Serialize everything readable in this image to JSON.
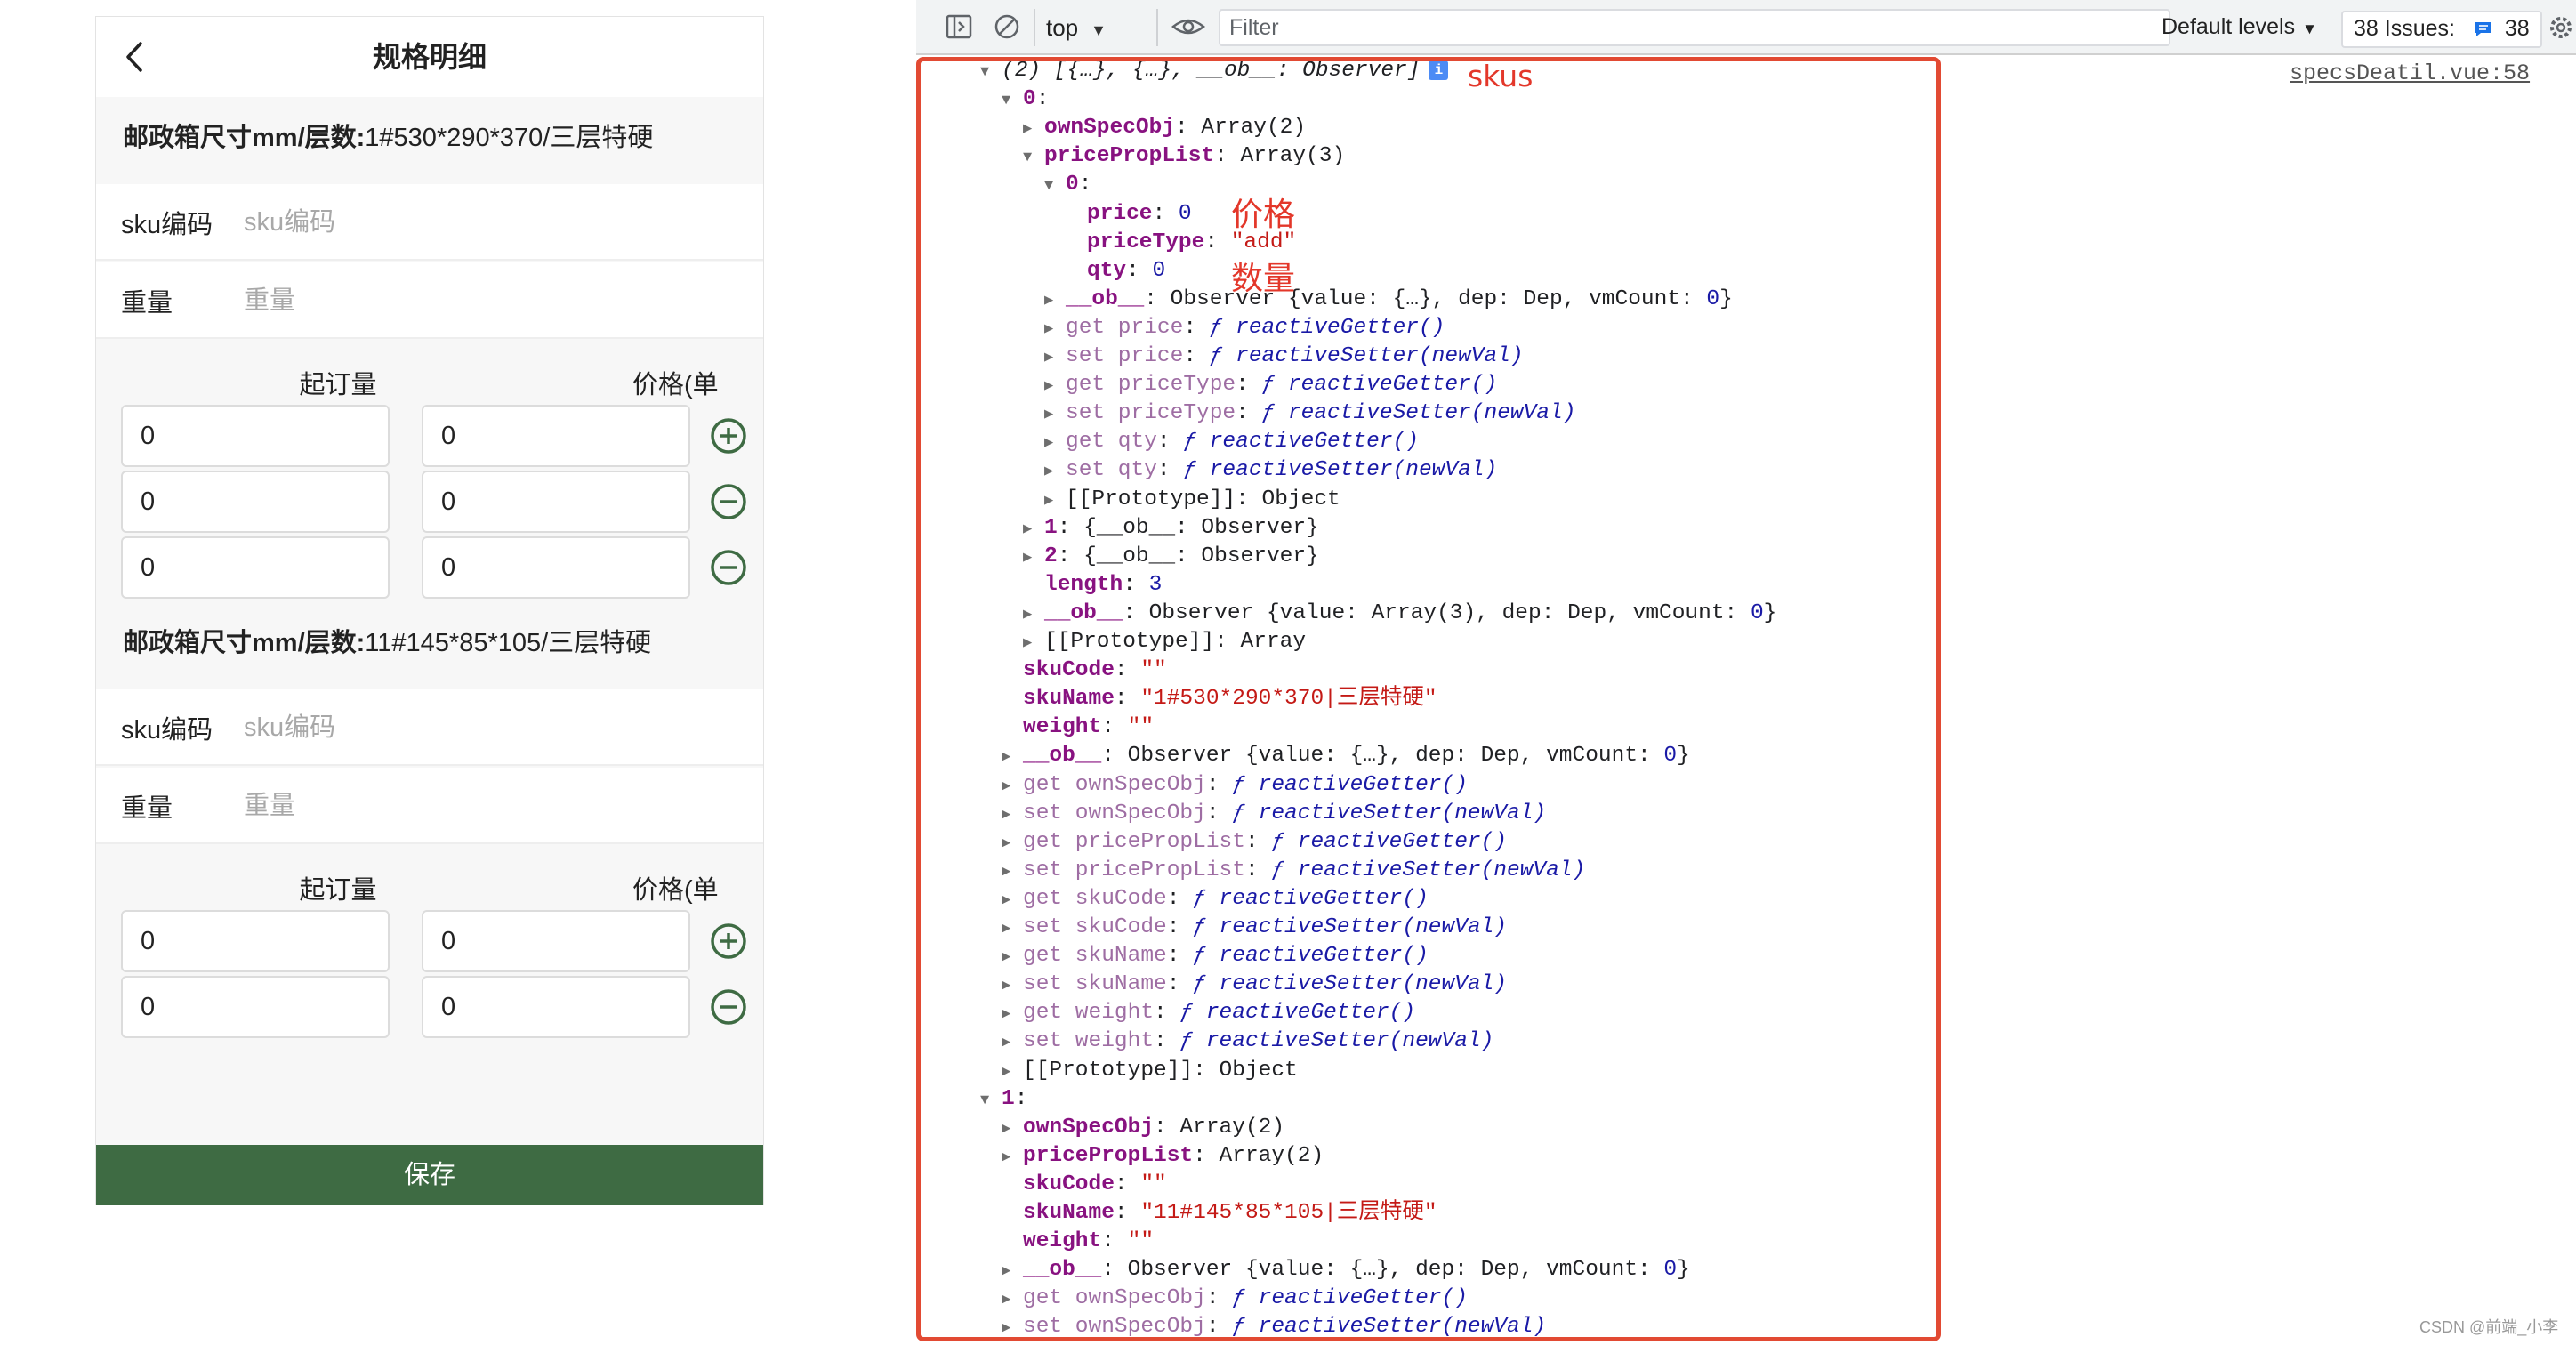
{
  "form": {
    "title": "规格明细",
    "save_label": "保存",
    "skus": [
      {
        "name_label": "邮政箱尺寸mm/层数:",
        "name_value": "1#530*290*370/三层特硬",
        "sku_code_label": "sku编码",
        "sku_code_placeholder": "sku编码",
        "weight_label": "重量",
        "weight_placeholder": "重量",
        "qty_header": "起订量",
        "price_header": "价格(单价)",
        "tiers": [
          {
            "qty": "0",
            "price": "0",
            "action": "add-circle-icon"
          },
          {
            "qty": "0",
            "price": "0",
            "action": "remove-circle-icon"
          },
          {
            "qty": "0",
            "price": "0",
            "action": "remove-circle-icon"
          }
        ]
      },
      {
        "name_label": "邮政箱尺寸mm/层数:",
        "name_value": "11#145*85*105/三层特硬",
        "sku_code_label": "sku编码",
        "sku_code_placeholder": "sku编码",
        "weight_label": "重量",
        "weight_placeholder": "重量",
        "qty_header": "起订量",
        "price_header": "价格(单价)",
        "tiers": [
          {
            "qty": "0",
            "price": "0",
            "action": "add-circle-icon"
          },
          {
            "qty": "0",
            "price": "0",
            "action": "remove-circle-icon"
          }
        ]
      }
    ]
  },
  "devtools": {
    "context": "top",
    "filter_placeholder": "Filter",
    "levels": "Default levels",
    "issues_label": "38 Issues:",
    "issues_count": "38",
    "source_link": "specsDeatil.vue:58",
    "lines": [
      [
        {
          "t": "▼",
          "c": "tri"
        },
        {
          "t": "(2) [{…}, {…}, __ob__: Observer]",
          "c": "it"
        },
        {
          "t": "i",
          "c": "info"
        }
      ],
      [
        {
          "t": "▼",
          "c": "tri"
        },
        {
          "t": "0",
          "c": "k"
        },
        {
          "t": ":"
        }
      ],
      [
        {
          "t": "▶",
          "c": "tri"
        },
        {
          "t": "ownSpecObj",
          "c": "k"
        },
        {
          "t": ": Array(2)"
        }
      ],
      [
        {
          "t": "▼",
          "c": "tri"
        },
        {
          "t": "pricePropList",
          "c": "k"
        },
        {
          "t": ": Array(3)"
        }
      ],
      [
        {
          "t": "▼",
          "c": "tri"
        },
        {
          "t": "0",
          "c": "k"
        },
        {
          "t": ":"
        }
      ],
      [
        {
          "t": "price",
          "c": "k"
        },
        {
          "t": ": "
        },
        {
          "t": "0",
          "c": "n"
        }
      ],
      [
        {
          "t": "priceType",
          "c": "k"
        },
        {
          "t": ": "
        },
        {
          "t": "\"add\"",
          "c": "s"
        }
      ],
      [
        {
          "t": "qty",
          "c": "k"
        },
        {
          "t": ": "
        },
        {
          "t": "0",
          "c": "n"
        }
      ],
      [
        {
          "t": "▶",
          "c": "tri"
        },
        {
          "t": "__ob__",
          "c": "k"
        },
        {
          "t": ": Observer {value: {…}, dep: Dep, vmCount: "
        },
        {
          "t": "0",
          "c": "n"
        },
        {
          "t": "}"
        }
      ],
      [
        {
          "t": "▶",
          "c": "tri"
        },
        {
          "t": "get price",
          "c": "ka"
        },
        {
          "t": ": "
        },
        {
          "t": "ƒ reactiveGetter()",
          "c": "fn"
        }
      ],
      [
        {
          "t": "▶",
          "c": "tri"
        },
        {
          "t": "set price",
          "c": "ka"
        },
        {
          "t": ": "
        },
        {
          "t": "ƒ reactiveSetter(newVal)",
          "c": "fn"
        }
      ],
      [
        {
          "t": "▶",
          "c": "tri"
        },
        {
          "t": "get priceType",
          "c": "ka"
        },
        {
          "t": ": "
        },
        {
          "t": "ƒ reactiveGetter()",
          "c": "fn"
        }
      ],
      [
        {
          "t": "▶",
          "c": "tri"
        },
        {
          "t": "set priceType",
          "c": "ka"
        },
        {
          "t": ": "
        },
        {
          "t": "ƒ reactiveSetter(newVal)",
          "c": "fn"
        }
      ],
      [
        {
          "t": "▶",
          "c": "tri"
        },
        {
          "t": "get qty",
          "c": "ka"
        },
        {
          "t": ": "
        },
        {
          "t": "ƒ reactiveGetter()",
          "c": "fn"
        }
      ],
      [
        {
          "t": "▶",
          "c": "tri"
        },
        {
          "t": "set qty",
          "c": "ka"
        },
        {
          "t": ": "
        },
        {
          "t": "ƒ reactiveSetter(newVal)",
          "c": "fn"
        }
      ],
      [
        {
          "t": "▶",
          "c": "tri"
        },
        {
          "t": "[[Prototype]]: Object"
        }
      ],
      [
        {
          "t": "▶",
          "c": "tri"
        },
        {
          "t": "1",
          "c": "k"
        },
        {
          "t": ": {__ob__: Observer}"
        }
      ],
      [
        {
          "t": "▶",
          "c": "tri"
        },
        {
          "t": "2",
          "c": "k"
        },
        {
          "t": ": {__ob__: Observer}"
        }
      ],
      [
        {
          "t": "length",
          "c": "k"
        },
        {
          "t": ": "
        },
        {
          "t": "3",
          "c": "n"
        }
      ],
      [
        {
          "t": "▶",
          "c": "tri"
        },
        {
          "t": "__ob__",
          "c": "k"
        },
        {
          "t": ": Observer {value: Array(3), dep: Dep, vmCount: "
        },
        {
          "t": "0",
          "c": "n"
        },
        {
          "t": "}"
        }
      ],
      [
        {
          "t": "▶",
          "c": "tri"
        },
        {
          "t": "[[Prototype]]: Array"
        }
      ],
      [
        {
          "t": "skuCode",
          "c": "k"
        },
        {
          "t": ": "
        },
        {
          "t": "\"\"",
          "c": "s"
        }
      ],
      [
        {
          "t": "skuName",
          "c": "k"
        },
        {
          "t": ": "
        },
        {
          "t": "\"1#530*290*370|三层特硬\"",
          "c": "s"
        }
      ],
      [
        {
          "t": "weight",
          "c": "k"
        },
        {
          "t": ": "
        },
        {
          "t": "\"\"",
          "c": "s"
        }
      ],
      [
        {
          "t": "▶",
          "c": "tri"
        },
        {
          "t": "__ob__",
          "c": "k"
        },
        {
          "t": ": Observer {value: {…}, dep: Dep, vmCount: "
        },
        {
          "t": "0",
          "c": "n"
        },
        {
          "t": "}"
        }
      ],
      [
        {
          "t": "▶",
          "c": "tri"
        },
        {
          "t": "get ownSpecObj",
          "c": "ka"
        },
        {
          "t": ": "
        },
        {
          "t": "ƒ reactiveGetter()",
          "c": "fn"
        }
      ],
      [
        {
          "t": "▶",
          "c": "tri"
        },
        {
          "t": "set ownSpecObj",
          "c": "ka"
        },
        {
          "t": ": "
        },
        {
          "t": "ƒ reactiveSetter(newVal)",
          "c": "fn"
        }
      ],
      [
        {
          "t": "▶",
          "c": "tri"
        },
        {
          "t": "get pricePropList",
          "c": "ka"
        },
        {
          "t": ": "
        },
        {
          "t": "ƒ reactiveGetter()",
          "c": "fn"
        }
      ],
      [
        {
          "t": "▶",
          "c": "tri"
        },
        {
          "t": "set pricePropList",
          "c": "ka"
        },
        {
          "t": ": "
        },
        {
          "t": "ƒ reactiveSetter(newVal)",
          "c": "fn"
        }
      ],
      [
        {
          "t": "▶",
          "c": "tri"
        },
        {
          "t": "get skuCode",
          "c": "ka"
        },
        {
          "t": ": "
        },
        {
          "t": "ƒ reactiveGetter()",
          "c": "fn"
        }
      ],
      [
        {
          "t": "▶",
          "c": "tri"
        },
        {
          "t": "set skuCode",
          "c": "ka"
        },
        {
          "t": ": "
        },
        {
          "t": "ƒ reactiveSetter(newVal)",
          "c": "fn"
        }
      ],
      [
        {
          "t": "▶",
          "c": "tri"
        },
        {
          "t": "get skuName",
          "c": "ka"
        },
        {
          "t": ": "
        },
        {
          "t": "ƒ reactiveGetter()",
          "c": "fn"
        }
      ],
      [
        {
          "t": "▶",
          "c": "tri"
        },
        {
          "t": "set skuName",
          "c": "ka"
        },
        {
          "t": ": "
        },
        {
          "t": "ƒ reactiveSetter(newVal)",
          "c": "fn"
        }
      ],
      [
        {
          "t": "▶",
          "c": "tri"
        },
        {
          "t": "get weight",
          "c": "ka"
        },
        {
          "t": ": "
        },
        {
          "t": "ƒ reactiveGetter()",
          "c": "fn"
        }
      ],
      [
        {
          "t": "▶",
          "c": "tri"
        },
        {
          "t": "set weight",
          "c": "ka"
        },
        {
          "t": ": "
        },
        {
          "t": "ƒ reactiveSetter(newVal)",
          "c": "fn"
        }
      ],
      [
        {
          "t": "▶",
          "c": "tri"
        },
        {
          "t": "[[Prototype]]: Object"
        }
      ],
      [
        {
          "t": "▼",
          "c": "tri"
        },
        {
          "t": "1",
          "c": "k"
        },
        {
          "t": ":"
        }
      ],
      [
        {
          "t": "▶",
          "c": "tri"
        },
        {
          "t": "ownSpecObj",
          "c": "k"
        },
        {
          "t": ": Array(2)"
        }
      ],
      [
        {
          "t": "▶",
          "c": "tri"
        },
        {
          "t": "pricePropList",
          "c": "k"
        },
        {
          "t": ": Array(2)"
        }
      ],
      [
        {
          "t": "skuCode",
          "c": "k"
        },
        {
          "t": ": "
        },
        {
          "t": "\"\"",
          "c": "s"
        }
      ],
      [
        {
          "t": "skuName",
          "c": "k"
        },
        {
          "t": ": "
        },
        {
          "t": "\"11#145*85*105|三层特硬\"",
          "c": "s"
        }
      ],
      [
        {
          "t": "weight",
          "c": "k"
        },
        {
          "t": ": "
        },
        {
          "t": "\"\"",
          "c": "s"
        }
      ],
      [
        {
          "t": "▶",
          "c": "tri"
        },
        {
          "t": "__ob__",
          "c": "k"
        },
        {
          "t": ": Observer {value: {…}, dep: Dep, vmCount: "
        },
        {
          "t": "0",
          "c": "n"
        },
        {
          "t": "}"
        }
      ],
      [
        {
          "t": "▶",
          "c": "tri"
        },
        {
          "t": "get ownSpecObj",
          "c": "ka"
        },
        {
          "t": ": "
        },
        {
          "t": "ƒ reactiveGetter()",
          "c": "fn"
        }
      ],
      [
        {
          "t": "▶",
          "c": "tri"
        },
        {
          "t": "set ownSpecObj",
          "c": "ka"
        },
        {
          "t": ": "
        },
        {
          "t": "ƒ reactiveSetter(newVal)",
          "c": "fn"
        }
      ]
    ],
    "indents": [
      0,
      1,
      2,
      2,
      3,
      4,
      4,
      4,
      3,
      3,
      3,
      3,
      3,
      3,
      3,
      3,
      2,
      2,
      2,
      2,
      2,
      1,
      1,
      1,
      1,
      1,
      1,
      1,
      1,
      1,
      1,
      1,
      1,
      1,
      1,
      1,
      0,
      1,
      1,
      1,
      1,
      1,
      1,
      1,
      1
    ],
    "annotations": {
      "skus": "skus",
      "price": "价格",
      "qty": "数量"
    }
  },
  "watermark": "CSDN @前端_小李"
}
